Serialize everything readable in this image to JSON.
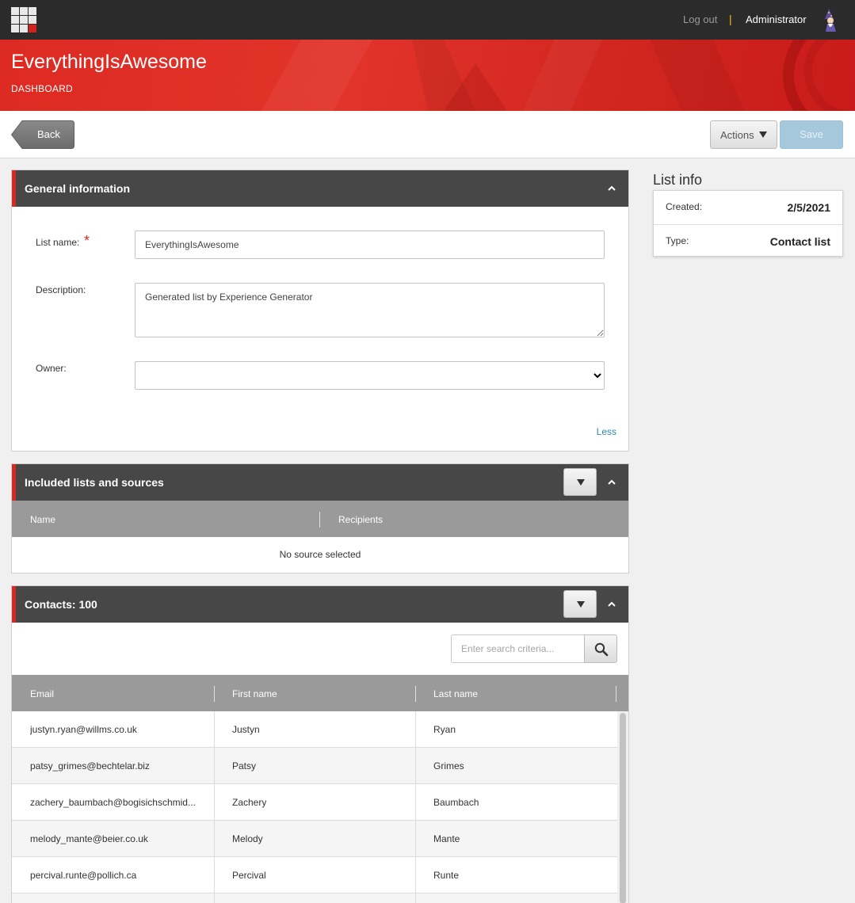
{
  "topbar": {
    "logout_label": "Log out",
    "separator": "|",
    "user_name": "Administrator"
  },
  "banner": {
    "title": "EverythingIsAwesome",
    "subtitle": "DASHBOARD"
  },
  "toolbar": {
    "back_label": "Back",
    "actions_label": "Actions",
    "save_label": "Save"
  },
  "general_info": {
    "title": "General information",
    "list_name_label": "List name:",
    "list_name_value": "EverythingIsAwesome",
    "description_label": "Description:",
    "description_value": "Generated list by Experience Generator",
    "owner_label": "Owner:",
    "owner_value": "",
    "less_label": "Less"
  },
  "included_lists": {
    "title": "Included lists and sources",
    "columns": [
      "Name",
      "Recipients"
    ],
    "empty_message": "No source selected"
  },
  "contacts": {
    "title": "Contacts: 100",
    "search_placeholder": "Enter search criteria...",
    "columns": [
      "Email",
      "First name",
      "Last name"
    ],
    "rows": [
      {
        "email": "justyn.ryan@willms.co.uk",
        "first": "Justyn",
        "last": "Ryan"
      },
      {
        "email": "patsy_grimes@bechtelar.biz",
        "first": "Patsy",
        "last": "Grimes"
      },
      {
        "email": "zachery_baumbach@bogisichschmid...",
        "first": "Zachery",
        "last": "Baumbach"
      },
      {
        "email": "melody_mante@beier.co.uk",
        "first": "Melody",
        "last": "Mante"
      },
      {
        "email": "percival.runte@pollich.ca",
        "first": "Percival",
        "last": "Runte"
      },
      {
        "email": "",
        "first": "",
        "last": ""
      }
    ]
  },
  "list_info": {
    "title": "List info",
    "created_label": "Created:",
    "created_value": "2/5/2021",
    "type_label": "Type:",
    "type_value": "Contact list"
  },
  "colors": {
    "brand_red": "#d52a21",
    "header_dark": "#2b2b2b",
    "panel_header": "#474747",
    "link_blue": "#2b86b9"
  },
  "icons": [
    "app-launcher-icon",
    "wizard-avatar-icon",
    "chevron-up-icon",
    "caret-down-icon",
    "search-icon"
  ]
}
